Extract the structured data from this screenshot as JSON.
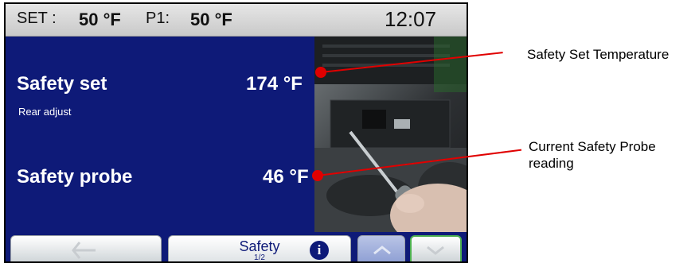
{
  "status_bar": {
    "set_label": "SET :",
    "set_value": "50 °F",
    "p1_label": "P1:",
    "p1_value": "50 °F",
    "time": "12:07"
  },
  "main": {
    "safety_set_label": "Safety set",
    "safety_set_value": "174 °F",
    "rear_adjust": "Rear adjust",
    "safety_probe_label": "Safety probe",
    "safety_probe_value": "46 °F"
  },
  "bottom_bar": {
    "tab_title": "Safety",
    "tab_page": "1/2"
  },
  "annotations": {
    "safety_set_callout": "Safety Set Temperature",
    "probe_callout": "Current Safety Probe reading"
  },
  "colors": {
    "panel_bg": "#0e1a78",
    "callout_red": "#e00000",
    "down_button_outline": "#4caf50"
  }
}
